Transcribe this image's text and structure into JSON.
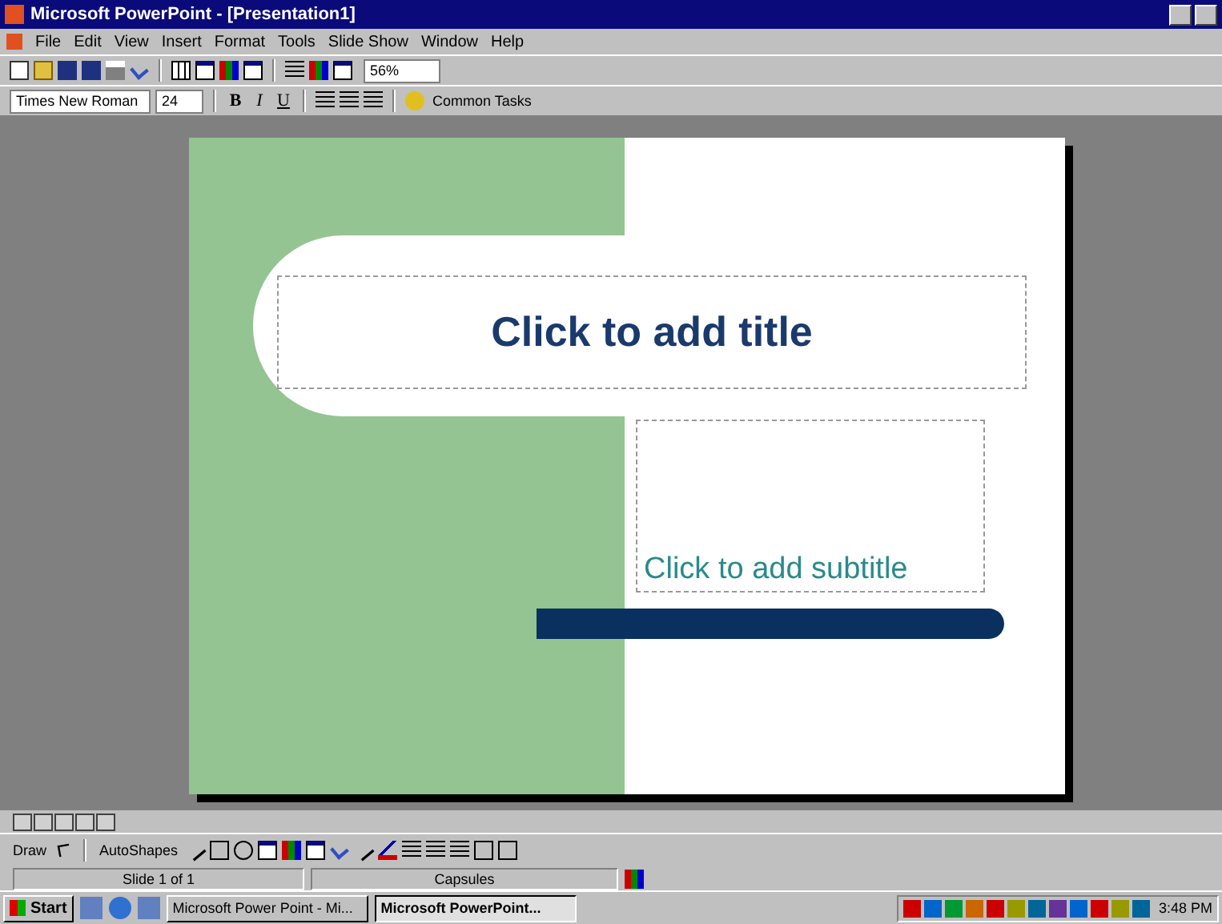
{
  "window": {
    "title": "Microsoft PowerPoint - [Presentation1]"
  },
  "menu": [
    "File",
    "Edit",
    "View",
    "Insert",
    "Format",
    "Tools",
    "Slide Show",
    "Window",
    "Help"
  ],
  "formatting": {
    "font": "Times New Roman",
    "size": "24",
    "bold": "B",
    "italic": "I",
    "underline": "U",
    "zoom": "56%",
    "common_tasks": "Common Tasks"
  },
  "slide": {
    "title_placeholder": "Click to add title",
    "subtitle_placeholder": "Click to add subtitle"
  },
  "drawing_toolbar": {
    "draw": "Draw",
    "autoshapes": "AutoShapes"
  },
  "status_bar": {
    "slide": "Slide 1 of 1",
    "design": "Capsules"
  },
  "taskbar": {
    "start": "Start",
    "tasks": [
      {
        "label": "Microsoft Power Point - Mi...",
        "selected": false
      },
      {
        "label": "Microsoft PowerPoint...",
        "selected": true
      }
    ],
    "clock": "3:48 PM"
  }
}
